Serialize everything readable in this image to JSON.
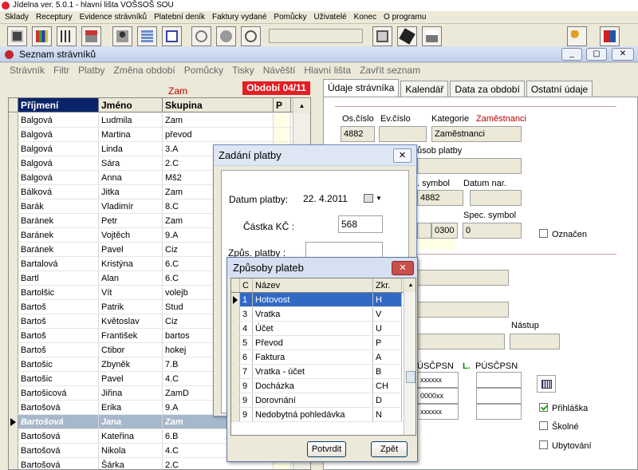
{
  "app": {
    "title": "Jídelna ver. 5.0.1 - hlavní lišta  VOŠSOŠ SOU"
  },
  "main_menu": [
    "Sklady",
    "Receptury",
    "Evidence strávníků",
    "Platební deník",
    "Faktury vydané",
    "Pomůcky",
    "Uživatelé",
    "Konec",
    "O programu"
  ],
  "toolbar": {
    "icons": [
      "warehouse-icon",
      "books-icon",
      "tools-icon",
      "register-icon",
      "person-icon",
      "calculator-icon",
      "terminal-icon",
      "browser-icon",
      "satellite-icon",
      "satellite-dish-icon",
      "card-reader-icon",
      "chip-card-icon",
      "printer-icon",
      "key-icon",
      "exit-icon"
    ]
  },
  "window": {
    "title": "Seznam strávníků",
    "menu": [
      "Strávník",
      "Filtr",
      "Platby",
      "Změna období",
      "Pomůcky",
      "Tisky",
      "Návěští",
      "Hlavní lišta",
      "Zavřít seznam"
    ],
    "column_caption": "Zam",
    "period": "Období 04/11"
  },
  "grid": {
    "columns": [
      "Příjmení",
      "Jméno",
      "Skupina",
      "P"
    ],
    "rows": [
      [
        "Balgová",
        "Ludmila",
        "Zam"
      ],
      [
        "Balgová",
        "Martina",
        "převod"
      ],
      [
        "Balgová",
        "Linda",
        "3.A"
      ],
      [
        "Balgová",
        "Sára",
        "2.C"
      ],
      [
        "Balgová",
        "Anna",
        "Mš2"
      ],
      [
        "Bálková",
        "Jitka",
        "Zam"
      ],
      [
        "Barák",
        "Vladimír",
        "8.C"
      ],
      [
        "Baránek",
        "Petr",
        "Zam"
      ],
      [
        "Baránek",
        "Vojtěch",
        "9.A"
      ],
      [
        "Baránek",
        "Pavel",
        "Ciz"
      ],
      [
        "Bartalová",
        "Kristýna",
        "6.C"
      ],
      [
        "Bartl",
        "Alan",
        "6.C"
      ],
      [
        "Bartolšic",
        "Vít",
        "volejb"
      ],
      [
        "Bartoš",
        "Patrik",
        "Stud"
      ],
      [
        "Bartoš",
        "Květoslav",
        "Ciz"
      ],
      [
        "Bartoš",
        "František",
        "bartos"
      ],
      [
        "Bartoš",
        "Ctibor",
        "hokej"
      ],
      [
        "Bartošic",
        "Zbyněk",
        "7.B"
      ],
      [
        "Bartošic",
        "Pavel",
        "4.C"
      ],
      [
        "Bartošicová",
        "Jiřina",
        "ZamD"
      ],
      [
        "Bartošová",
        "Erika",
        "9.A"
      ],
      [
        "Bartošová",
        "Jana",
        "Zam"
      ],
      [
        "Bartošová",
        "Kateřina",
        "6.B"
      ],
      [
        "Bartošová",
        "Nikola",
        "4.C"
      ],
      [
        "Bartošová",
        "Šárka",
        "2.C"
      ]
    ]
  },
  "tabs": [
    "Údaje strávníka",
    "Kalendář",
    "Data za období",
    "Ostatní údaje"
  ],
  "detail": {
    "os_cislo_label": "Os.číslo",
    "os_cislo": "4882",
    "ev_cislo_label": "Ev.číslo",
    "kategorie_label": "Kategorie",
    "kategorie_value": "Zaměstnanci",
    "kategorie_field": "Zaměstnanci",
    "zpusob_label": "ůsob platby",
    "symbol_label": ". symbol",
    "symbol_value": "4882",
    "datum_nar_label": "Datum nar.",
    "code_0300": "0300",
    "spec_symbol_label": "Spec. symbol",
    "spec_symbol": "0",
    "oznacen_label": "Označen",
    "nastup_label": "Nástup",
    "puscpsn_1": "ÚSČPSN",
    "l_label": "L.",
    "puscpsn_2": "PÚSČPSN",
    "masked_1": "xxxxxx",
    "masked_2": "0000xx",
    "masked_3": "xxxxxx",
    "prihlaska": "Přihláška",
    "skolne": "Školné",
    "ubytovani": "Ubytování"
  },
  "dialog_payment": {
    "title": "Zadání platby",
    "datum_label": "Datum platby:",
    "datum_value": "22.  4.2011",
    "castka_label": "Částka KČ :",
    "castka_value": "568",
    "zpus_label": "Způs. platby :",
    "zpus_value": ""
  },
  "dialog_methods": {
    "title": "Způsoby plateb",
    "columns": [
      "C",
      "Název",
      "Zkr."
    ],
    "rows": [
      [
        "1",
        "Hotovost",
        "H"
      ],
      [
        "3",
        "Vratka",
        "V"
      ],
      [
        "4",
        "Účet",
        "U"
      ],
      [
        "5",
        "Převod",
        "P"
      ],
      [
        "6",
        "Faktura",
        "A"
      ],
      [
        "7",
        "Vratka - účet",
        "B"
      ],
      [
        "9",
        "Docházka",
        "CH"
      ],
      [
        "9",
        "Dorovnání",
        "D"
      ],
      [
        "9",
        "Nedobytná pohledávka",
        "N"
      ]
    ],
    "confirm_label": "Potvrdit",
    "back_label": "Zpět"
  },
  "colors": {
    "period_bg": "#e31e24",
    "selection": "#316ac5",
    "header_selected": "#0a246a"
  }
}
